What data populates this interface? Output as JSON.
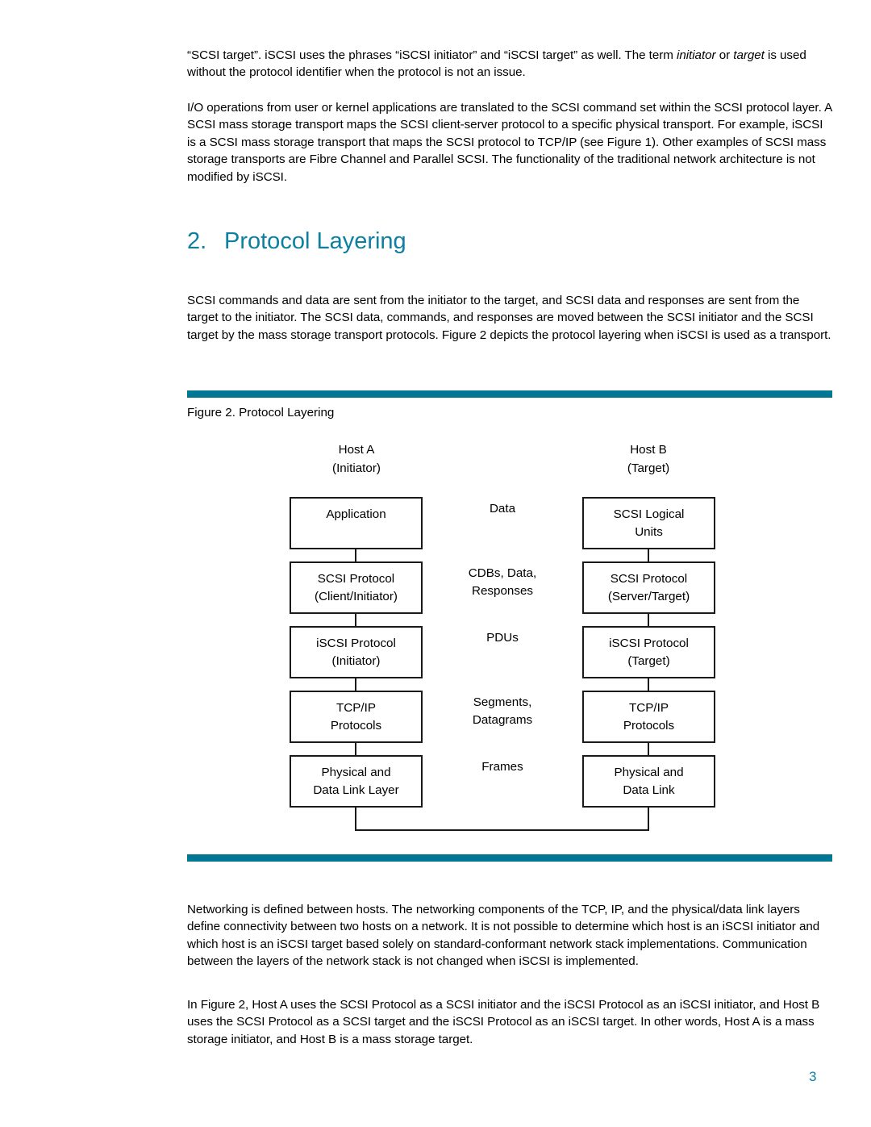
{
  "document": {
    "page_number": "3",
    "accent_color": "#007692",
    "heading_color": "#0d7fa0"
  },
  "paragraphs": {
    "p1": "“SCSI target”.  iSCSI uses the phrases “iSCSI initiator” and “iSCSI target” as well.  The term initiator or target is used without the protocol identifier when the protocol is not an issue.",
    "p1_parts": {
      "a": "“SCSI target”.  iSCSI uses the phrases “iSCSI initiator” and “iSCSI target” as well.  The term ",
      "i1": "initiator",
      "b": " or ",
      "i2": "target",
      "c": " is used without the protocol identifier when the protocol is not an issue."
    },
    "p2": "I/O operations from user or kernel applications are translated to the SCSI command set within the SCSI protocol layer.  A SCSI mass storage transport maps the SCSI client-server protocol to a specific physical transport.  For example, iSCSI is a SCSI mass storage transport that maps the SCSI protocol to TCP/IP (see Figure 1).  Other examples of SCSI mass storage transports are Fibre Channel and Parallel SCSI.  The functionality of the traditional network architecture is not modified by iSCSI.",
    "p3": "SCSI commands and data are sent from the initiator to the target, and SCSI data and responses are sent from the target to the initiator.  The SCSI data, commands, and responses are moved between the SCSI initiator and the SCSI target by the mass storage transport protocols.  Figure 2 depicts the protocol layering when iSCSI is used as a transport.",
    "p4": "Networking is defined between hosts.  The networking components of the TCP, IP, and the physical/data link layers define connectivity between two hosts on a network.  It is not possible to determine which host is an iSCSI initiator and which host is an iSCSI target based solely on standard-conformant network stack implementations.  Communication between the layers of the network stack is not changed when iSCSI is implemented.",
    "p5": "In Figure 2, Host A uses the SCSI Protocol as a SCSI initiator and the iSCSI Protocol as an iSCSI initiator, and Host B uses the SCSI Protocol as a SCSI target and the iSCSI Protocol as an iSCSI target.  In other words, Host A is a mass storage initiator, and Host B is a mass storage target."
  },
  "heading": {
    "number": "2.",
    "title": "Protocol Layering"
  },
  "figure": {
    "caption": "Figure 2. Protocol Layering",
    "host_a": {
      "line1": "Host A",
      "line2": "(Initiator)"
    },
    "host_b": {
      "line1": "Host B",
      "line2": "(Target)"
    },
    "left_stack": [
      {
        "line1": "Application",
        "line2": ""
      },
      {
        "line1": "SCSI Protocol",
        "line2": "(Client/Initiator)"
      },
      {
        "line1": "iSCSI Protocol",
        "line2": "(Initiator)"
      },
      {
        "line1": "TCP/IP",
        "line2": "Protocols"
      },
      {
        "line1": "Physical and",
        "line2": "Data Link Layer"
      }
    ],
    "right_stack": [
      {
        "line1": "SCSI Logical",
        "line2": "Units"
      },
      {
        "line1": "SCSI Protocol",
        "line2": "(Server/Target)"
      },
      {
        "line1": "iSCSI Protocol",
        "line2": "(Target)"
      },
      {
        "line1": "TCP/IP",
        "line2": "Protocols"
      },
      {
        "line1": "Physical and",
        "line2": "Data Link"
      }
    ],
    "middle_labels": [
      {
        "line1": "Data",
        "line2": ""
      },
      {
        "line1": "CDBs, Data,",
        "line2": "Responses"
      },
      {
        "line1": "PDUs",
        "line2": ""
      },
      {
        "line1": "Segments,",
        "line2": "Datagrams"
      },
      {
        "line1": "Frames",
        "line2": ""
      }
    ]
  }
}
